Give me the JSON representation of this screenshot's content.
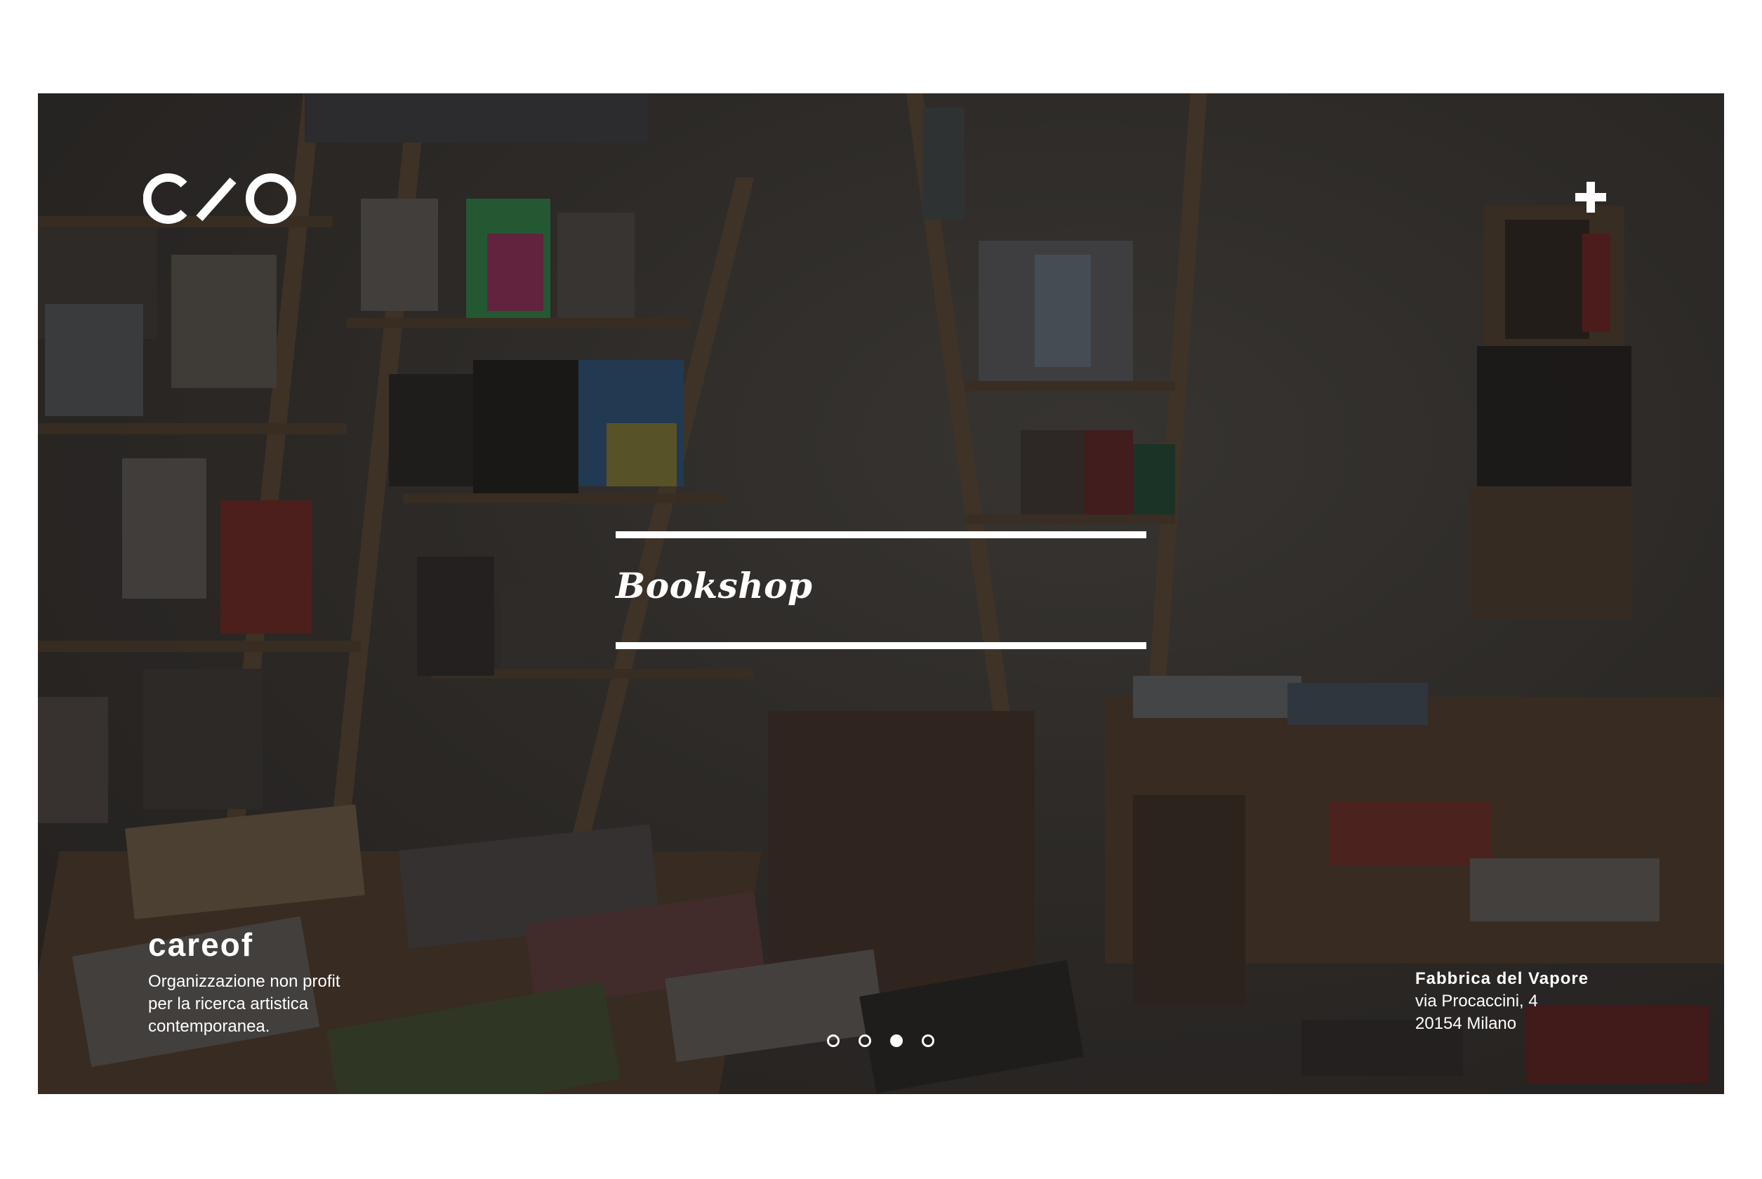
{
  "logo": {
    "text": "C/O",
    "color": "#ffffff"
  },
  "menu": {
    "icon": "plus-icon"
  },
  "hero": {
    "title": "Bookshop"
  },
  "org": {
    "name": "careof",
    "description": [
      "Organizzazione non profit",
      "per la ricerca artistica",
      "contemporanea."
    ]
  },
  "address": {
    "venue": "Fabbrica del Vapore",
    "street": "via Procaccini, 4",
    "city": "20154 Milano"
  },
  "slider": {
    "count": 4,
    "active_index": 3
  },
  "colors": {
    "text": "#ffffff",
    "page_background": "#ffffff",
    "overlay": "#1a1714"
  }
}
